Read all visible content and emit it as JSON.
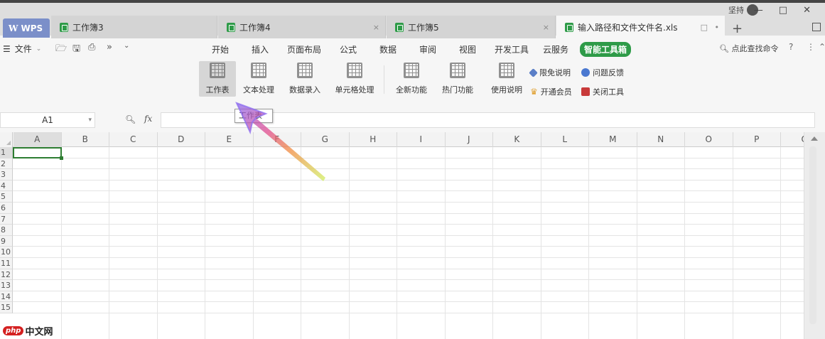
{
  "tabbar": {
    "wps_label": "WPS",
    "tabs": [
      {
        "label": "工作簿3"
      },
      {
        "label": "工作簿4"
      },
      {
        "label": "工作簿5"
      },
      {
        "label": "输入路径和文件文件名.xls"
      }
    ],
    "user": "坚持",
    "new_tab": "+"
  },
  "menubar": {
    "file_label": "文件",
    "items": [
      "开始",
      "插入",
      "页面布局",
      "公式",
      "数据",
      "审阅",
      "视图",
      "开发工具",
      "云服务",
      "智能工具箱"
    ],
    "search_placeholder": "点此查找命令"
  },
  "ribbon": {
    "big_buttons": [
      "工作表",
      "文本处理",
      "数据录入",
      "单元格处理",
      "全新功能",
      "热门功能",
      "使用说明"
    ],
    "small_buttons": [
      "限免说明",
      "问题反馈",
      "开通会员",
      "关闭工具"
    ]
  },
  "formula_bar": {
    "namebox": "A1",
    "fx": "fx",
    "tooltip": "工作表"
  },
  "grid": {
    "columns": [
      "A",
      "B",
      "C",
      "D",
      "E",
      "F",
      "G",
      "H",
      "I",
      "J",
      "K",
      "L",
      "M",
      "N",
      "O",
      "P",
      "Q"
    ],
    "rows": [
      "1",
      "2",
      "3",
      "4",
      "5",
      "6",
      "7",
      "8",
      "9",
      "10",
      "11",
      "12",
      "13",
      "14",
      "15"
    ]
  },
  "watermark": {
    "logo": "php",
    "text": "中文网"
  },
  "colors": {
    "accent": "#2e9b48",
    "wps_tab": "#7b8fc9",
    "selection": "#2e7d32"
  }
}
